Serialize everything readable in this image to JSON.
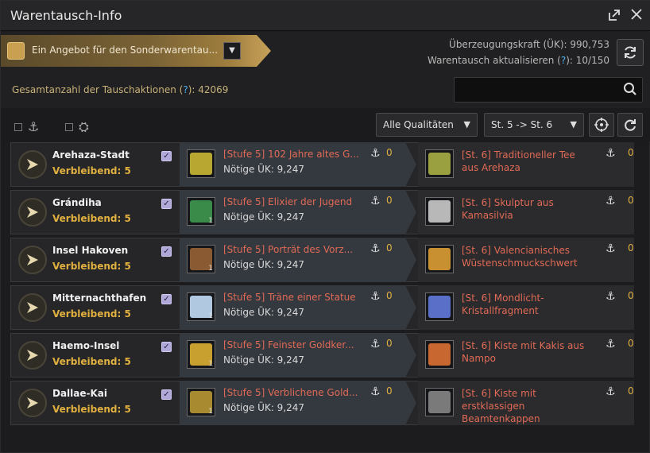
{
  "window": {
    "title": "Warentausch-Info",
    "icons": [
      "expand-icon",
      "close-icon"
    ]
  },
  "header": {
    "offer_label": "Ein Angebot für den Sonderwarentau...",
    "uk_label": "Überzeugungskraft (ÜK): 990,753",
    "refresh_label_prefix": "Warentausch aktualisieren (",
    "refresh_q": "?",
    "refresh_label_suffix": "): 10/150",
    "total_prefix": "Gesamtanzahl der Tauschaktionen (",
    "total_q": "?",
    "total_suffix": "): 42069",
    "search_placeholder": ""
  },
  "filters": {
    "quality_select": "Alle Qualitäten",
    "level_select": "St. 5 -> St. 6"
  },
  "colors": {
    "accent_gold": "#e0b040",
    "item_red": "#e06a55",
    "question_blue": "#4fb0f0"
  },
  "rows": [
    {
      "npc": "Arehaza-Stadt",
      "remain": "Verbleibend: 5",
      "give_name": "[Stufe 5] 102 Jahre altes G...",
      "give_uk": "Nötige ÜK: 9,247",
      "give_count": "0",
      "give_qty": "",
      "give_icon_color": "#b8a832",
      "get_name": "[St. 6] Traditioneller Tee aus Arehaza",
      "get_count": "0",
      "get_icon_color": "#9aa040"
    },
    {
      "npc": "Grándiha",
      "remain": "Verbleibend: 5",
      "give_name": "[Stufe 5] Elixier der Jugend",
      "give_uk": "Nötige ÜK: 9,247",
      "give_count": "0",
      "give_qty": "1",
      "give_icon_color": "#3a8a4a",
      "get_name": "[St. 6] Skulptur aus Kamasilvia",
      "get_count": "0",
      "get_icon_color": "#b8b8b8"
    },
    {
      "npc": "Insel Hakoven",
      "remain": "Verbleibend: 5",
      "give_name": "[Stufe 5] Porträt des Vorz...",
      "give_uk": "Nötige ÜK: 9,247",
      "give_count": "0",
      "give_qty": "1",
      "give_icon_color": "#8a5a32",
      "get_name": "[St. 6] Valencianisches Wüstenschmuckschwert",
      "get_count": "0",
      "get_icon_color": "#c89030"
    },
    {
      "npc": "Mitternachthafen",
      "remain": "Verbleibend: 5",
      "give_name": "[Stufe 5] Träne einer Statue",
      "give_uk": "Nötige ÜK: 9,247",
      "give_count": "0",
      "give_qty": "1",
      "give_icon_color": "#b0c8e0",
      "get_name": "[St. 6] Mondlicht-Kristallfragment",
      "get_count": "0",
      "get_icon_color": "#5a70c8"
    },
    {
      "npc": "Haemo-Insel",
      "remain": "Verbleibend: 5",
      "give_name": "[Stufe 5] Feinster Goldker...",
      "give_uk": "Nötige ÜK: 9,247",
      "give_count": "0",
      "give_qty": "1",
      "give_icon_color": "#c8a030",
      "get_name": "[St. 6] Kiste mit Kakis aus Nampo",
      "get_count": "0",
      "get_icon_color": "#c86830"
    },
    {
      "npc": "Dallae-Kai",
      "remain": "Verbleibend: 5",
      "give_name": "[Stufe 5] Verblichene Gold...",
      "give_uk": "Nötige ÜK: 9,247",
      "give_count": "0",
      "give_qty": "1",
      "give_icon_color": "#a88a30",
      "get_name": "[St. 6] Kiste mit erstklassigen Beamtenkappen",
      "get_count": "0",
      "get_icon_color": "#7a7a7a"
    }
  ]
}
